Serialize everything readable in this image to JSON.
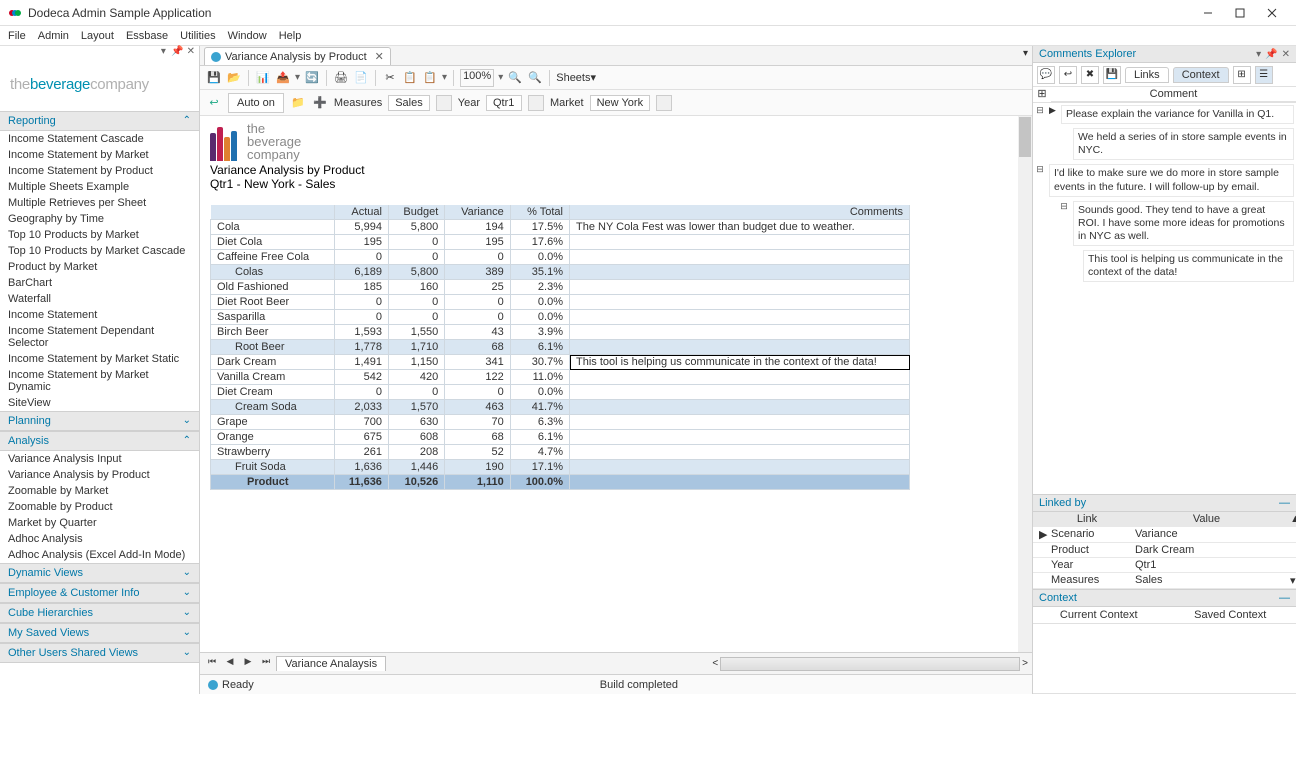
{
  "window": {
    "title": "Dodeca Admin Sample Application"
  },
  "menubar": [
    "File",
    "Admin",
    "Layout",
    "Essbase",
    "Utilities",
    "Window",
    "Help"
  ],
  "logo": {
    "t1": "the",
    "t2": "beverage",
    "t3": "company"
  },
  "nav": {
    "sections": [
      {
        "title": "Reporting",
        "items": [
          "Income Statement Cascade",
          "Income Statement by Market",
          "Income Statement by Product",
          "Multiple Sheets Example",
          "Multiple Retrieves per Sheet",
          "Geography by Time",
          "Top 10 Products by Market",
          "Top 10 Products by Market Cascade",
          "Product by Market",
          "BarChart",
          "Waterfall",
          "Income Statement",
          "Income Statement Dependant Selector",
          "Income Statement by Market Static",
          "Income Statement by Market Dynamic",
          "SiteView"
        ]
      },
      {
        "title": "Planning",
        "items": []
      },
      {
        "title": "Analysis",
        "items": [
          "Variance Analysis Input",
          "Variance Analysis by Product",
          "Zoomable by Market",
          "Zoomable by Product",
          "Market by Quarter",
          "Adhoc Analysis",
          "Adhoc Analysis (Excel Add-In Mode)"
        ]
      },
      {
        "title": "Dynamic Views",
        "items": []
      },
      {
        "title": "Employee & Customer Info",
        "items": []
      },
      {
        "title": "Cube Hierarchies",
        "items": []
      },
      {
        "title": "My Saved Views",
        "items": []
      },
      {
        "title": "Other Users Shared Views",
        "items": []
      }
    ]
  },
  "tab": {
    "label": "Variance Analysis by Product"
  },
  "toolbar": {
    "zoom": "100%",
    "sheets": "Sheets"
  },
  "toolbar2": {
    "auto": "Auto on",
    "measures": {
      "label": "Measures",
      "value": "Sales"
    },
    "year": {
      "label": "Year",
      "value": "Qtr1"
    },
    "market": {
      "label": "Market",
      "value": "New York"
    }
  },
  "report": {
    "title": "Variance Analysis by Product",
    "subtitle": "Qtr1 - New York - Sales",
    "columns": [
      "",
      "Actual",
      "Budget",
      "Variance",
      "% Total",
      "Comments"
    ],
    "rows": [
      {
        "type": "data",
        "cells": [
          "Cola",
          "5,994",
          "5,800",
          "194",
          "17.5%",
          "The NY Cola Fest was lower than budget due to weather."
        ]
      },
      {
        "type": "data",
        "cells": [
          "Diet Cola",
          "195",
          "0",
          "195",
          "17.6%",
          ""
        ]
      },
      {
        "type": "data",
        "cells": [
          "Caffeine Free Cola",
          "0",
          "0",
          "0",
          "0.0%",
          ""
        ]
      },
      {
        "type": "sub",
        "cells": [
          "Colas",
          "6,189",
          "5,800",
          "389",
          "35.1%",
          ""
        ]
      },
      {
        "type": "data",
        "cells": [
          "Old Fashioned",
          "185",
          "160",
          "25",
          "2.3%",
          ""
        ]
      },
      {
        "type": "data",
        "cells": [
          "Diet Root Beer",
          "0",
          "0",
          "0",
          "0.0%",
          ""
        ]
      },
      {
        "type": "data",
        "cells": [
          "Sasparilla",
          "0",
          "0",
          "0",
          "0.0%",
          ""
        ]
      },
      {
        "type": "data",
        "cells": [
          "Birch Beer",
          "1,593",
          "1,550",
          "43",
          "3.9%",
          ""
        ]
      },
      {
        "type": "sub",
        "cells": [
          "Root Beer",
          "1,778",
          "1,710",
          "68",
          "6.1%",
          ""
        ]
      },
      {
        "type": "data",
        "selected": true,
        "cells": [
          "Dark Cream",
          "1,491",
          "1,150",
          "341",
          "30.7%",
          "This tool is helping us communicate in the context of the data!"
        ]
      },
      {
        "type": "data",
        "cells": [
          "Vanilla Cream",
          "542",
          "420",
          "122",
          "11.0%",
          ""
        ]
      },
      {
        "type": "data",
        "cells": [
          "Diet Cream",
          "0",
          "0",
          "0",
          "0.0%",
          ""
        ]
      },
      {
        "type": "sub",
        "cells": [
          "Cream Soda",
          "2,033",
          "1,570",
          "463",
          "41.7%",
          ""
        ]
      },
      {
        "type": "data",
        "cells": [
          "Grape",
          "700",
          "630",
          "70",
          "6.3%",
          ""
        ]
      },
      {
        "type": "data",
        "cells": [
          "Orange",
          "675",
          "608",
          "68",
          "6.1%",
          ""
        ]
      },
      {
        "type": "data",
        "cells": [
          "Strawberry",
          "261",
          "208",
          "52",
          "4.7%",
          ""
        ]
      },
      {
        "type": "sub",
        "cells": [
          "Fruit Soda",
          "1,636",
          "1,446",
          "190",
          "17.1%",
          ""
        ]
      },
      {
        "type": "total",
        "cells": [
          "Product",
          "11,636",
          "10,526",
          "1,110",
          "100.0%",
          ""
        ]
      }
    ]
  },
  "sheettab": {
    "name": "Variance Analaysis"
  },
  "status": {
    "ready": "Ready",
    "build": "Build completed"
  },
  "comments": {
    "title": "Comments Explorer",
    "tabs": {
      "links": "Links",
      "context": "Context"
    },
    "header": "Comment",
    "thread": [
      {
        "level": 0,
        "text": "Please explain the variance for Vanilla in Q1."
      },
      {
        "level": 1,
        "text": "We held a series of in store sample events in NYC."
      },
      {
        "level": 0,
        "text": "I'd like to make sure we do more in store sample events in the future. I will follow-up by email."
      },
      {
        "level": 1,
        "text": "Sounds good. They tend to have a great ROI. I have some more ideas for promotions in NYC as well."
      },
      {
        "level": 2,
        "text": "This tool is helping us communicate in the context of the data!"
      }
    ]
  },
  "linkedby": {
    "title": "Linked by",
    "cols": [
      "Link",
      "Value"
    ],
    "rows": [
      [
        "Scenario",
        "Variance"
      ],
      [
        "Product",
        "Dark Cream"
      ],
      [
        "Year",
        "Qtr1"
      ],
      [
        "Measures",
        "Sales"
      ]
    ]
  },
  "context": {
    "title": "Context",
    "current": "Current Context",
    "saved": "Saved Context"
  },
  "chart_data": {
    "type": "table",
    "title": "Variance Analysis by Product — Qtr1 - New York - Sales",
    "columns": [
      "Product",
      "Actual",
      "Budget",
      "Variance",
      "% Total"
    ],
    "rows": [
      [
        "Cola",
        5994,
        5800,
        194,
        17.5
      ],
      [
        "Diet Cola",
        195,
        0,
        195,
        17.6
      ],
      [
        "Caffeine Free Cola",
        0,
        0,
        0,
        0.0
      ],
      [
        "Colas (subtotal)",
        6189,
        5800,
        389,
        35.1
      ],
      [
        "Old Fashioned",
        185,
        160,
        25,
        2.3
      ],
      [
        "Diet Root Beer",
        0,
        0,
        0,
        0.0
      ],
      [
        "Sasparilla",
        0,
        0,
        0,
        0.0
      ],
      [
        "Birch Beer",
        1593,
        1550,
        43,
        3.9
      ],
      [
        "Root Beer (subtotal)",
        1778,
        1710,
        68,
        6.1
      ],
      [
        "Dark Cream",
        1491,
        1150,
        341,
        30.7
      ],
      [
        "Vanilla Cream",
        542,
        420,
        122,
        11.0
      ],
      [
        "Diet Cream",
        0,
        0,
        0,
        0.0
      ],
      [
        "Cream Soda (subtotal)",
        2033,
        1570,
        463,
        41.7
      ],
      [
        "Grape",
        700,
        630,
        70,
        6.3
      ],
      [
        "Orange",
        675,
        608,
        68,
        6.1
      ],
      [
        "Strawberry",
        261,
        208,
        52,
        4.7
      ],
      [
        "Fruit Soda (subtotal)",
        1636,
        1446,
        190,
        17.1
      ],
      [
        "Product (total)",
        11636,
        10526,
        1110,
        100.0
      ]
    ]
  }
}
